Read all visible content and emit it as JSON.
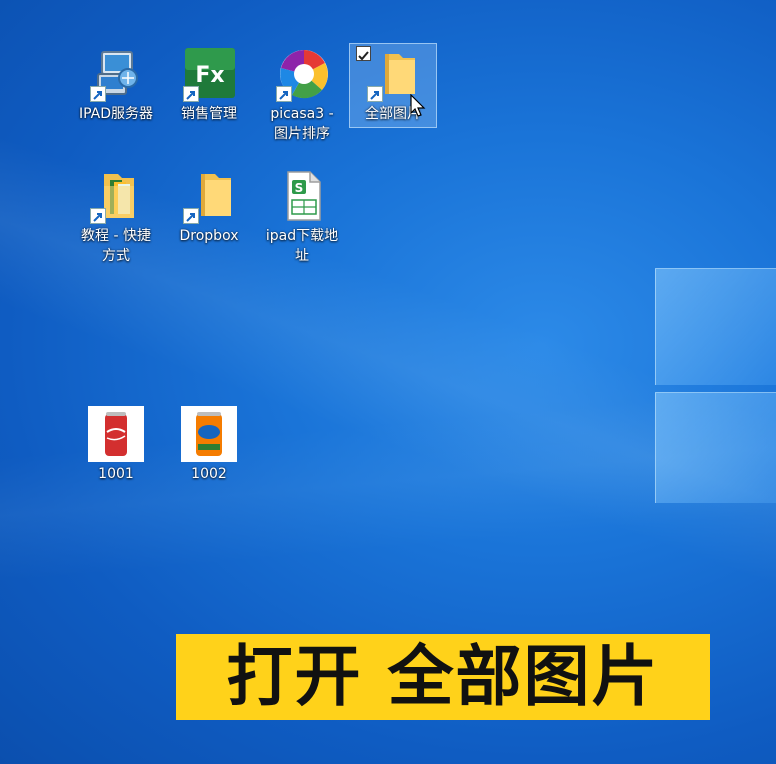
{
  "desktop": {
    "icons": [
      {
        "label": "IPAD服务器",
        "icon": "server-icon",
        "shortcut": true
      },
      {
        "label": "销售管理",
        "icon": "fx-app-icon",
        "shortcut": true
      },
      {
        "label": "picasa3 - 图片排序",
        "icon": "picasa-icon",
        "shortcut": true
      },
      {
        "label": "全部图片",
        "icon": "folder-icon",
        "shortcut": true,
        "selected": true
      },
      {
        "label": "教程 - 快捷方式",
        "icon": "book-folder-icon",
        "shortcut": true
      },
      {
        "label": "Dropbox",
        "icon": "folder-icon",
        "shortcut": true
      },
      {
        "label": "ipad下载地址",
        "icon": "spreadsheet-icon",
        "shortcut": false
      },
      {
        "label": "1001",
        "icon": "coca-cola-can-icon",
        "shortcut": false
      },
      {
        "label": "1002",
        "icon": "fanta-can-icon",
        "shortcut": false
      }
    ]
  },
  "caption": {
    "text": "打开 全部图片",
    "background": "#ffd21a"
  },
  "colors": {
    "desktop_blue": "#1a74d8",
    "selection": "#b4dcff"
  }
}
